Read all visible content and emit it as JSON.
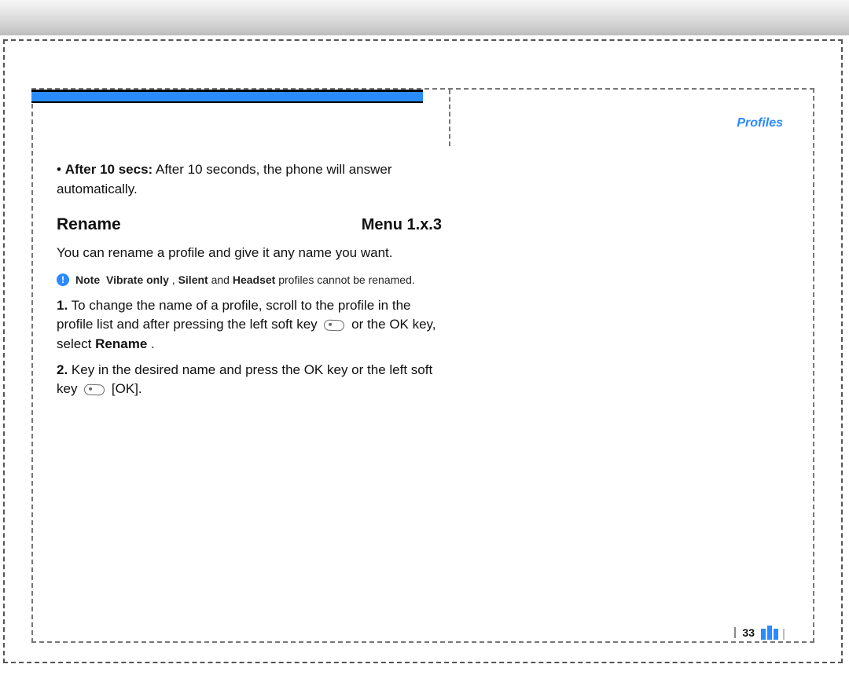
{
  "header": {
    "section_label": "Profiles"
  },
  "content": {
    "bullet": {
      "lead": "After 10 secs:",
      "text": " After 10 seconds, the phone will answer automatically."
    },
    "heading": {
      "title": "Rename",
      "menu": "Menu 1.x.3"
    },
    "intro": "You can rename a profile and give it any name you want.",
    "note": {
      "label": "Note",
      "body_pre": "",
      "b1": "Vibrate only",
      "sep1": ", ",
      "b2": "Silent",
      "sep2": " and ",
      "b3": "Headset",
      "body_post": " profiles cannot be renamed."
    },
    "steps": {
      "s1": {
        "num": "1.",
        "a": " To change the name of a profile, scroll to the profile in the profile list and after pressing the left soft key ",
        "b": " or the OK key, select ",
        "bold": "Rename",
        "c": "."
      },
      "s2": {
        "num": "2.",
        "a": " Key in the desired name and press the OK key or the left soft key ",
        "b": " [OK]."
      }
    }
  },
  "footer": {
    "page_number": "33"
  },
  "icons": {
    "softkey": "softkey-icon",
    "info": "info-icon"
  }
}
